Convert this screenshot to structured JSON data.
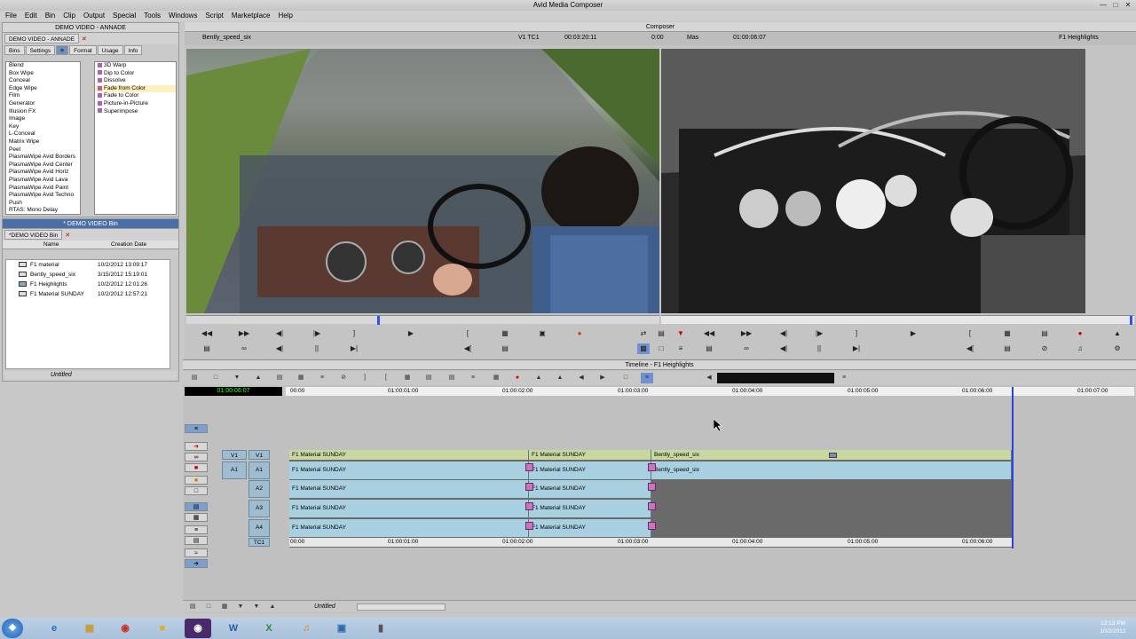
{
  "app": {
    "title": "Avid Media Composer"
  },
  "menu": [
    "File",
    "Edit",
    "Bin",
    "Clip",
    "Output",
    "Special",
    "Tools",
    "Windows",
    "Script",
    "Marketplace",
    "Help"
  ],
  "effects_palette": {
    "title": "DEMO VIDEO - ANNADE",
    "tab_title": "DEMO VIDEO - ANNADE",
    "tabs": [
      "Bins",
      "Settings",
      "Format",
      "Usage",
      "Info"
    ],
    "categories": [
      "Blend",
      "Box Wipe",
      "Conceal",
      "Edge Wipe",
      "Film",
      "Generator",
      "Illusion FX",
      "Image",
      "Key",
      "L-Conceal",
      "Matrix Wipe",
      "Peel",
      "PlasmaWipe Avid Borders",
      "PlasmaWipe Avid Center",
      "PlasmaWipe Avid Horiz",
      "PlasmaWipe Avid Lava",
      "PlasmaWipe Avid Paint",
      "PlasmaWipe Avid Techno",
      "Push",
      "RTAS: Mono Delay"
    ],
    "effects": [
      "3D Warp",
      "Dip to Color",
      "Dissolve",
      "Fade from Color",
      "Fade to Color",
      "Picture-in-Picture",
      "Superimpose"
    ]
  },
  "bin": {
    "window_title": "* DEMO VIDEO Bin",
    "tab_title": "*DEMO VIDEO Bin",
    "columns": [
      "Name",
      "Creation Date"
    ],
    "rows": [
      {
        "name": "F1 material",
        "date": "10/2/2012 13:09:17"
      },
      {
        "name": "Bently_speed_six",
        "date": "3/15/2012 15:19:01"
      },
      {
        "name": "F1 Heighlights",
        "date": "10/2/2012 12:01:26"
      },
      {
        "name": "F1 Material SUNDAY",
        "date": "10/2/2012 12:57:21"
      }
    ],
    "footer_label": "Untitled"
  },
  "composer": {
    "title": "Composer",
    "source_name": "Bently_speed_six",
    "track_tc": "V1  TC1",
    "tc_value": "00:03:20:11",
    "duration": "0:00",
    "mas_label": "Mas",
    "mas_value": "01:00:06:07",
    "record_name": "F1 Heighlights"
  },
  "timeline": {
    "title": "Timeline - F1 Heighlights",
    "current_tc": "01:00:06:07",
    "ruler_labels": [
      "00:00",
      "01:00:01:00",
      "01:00:02:00",
      "01:00:03:00",
      "01:00:04:00",
      "01:00:05:00",
      "01:00:06:00",
      "01:00:07:00"
    ],
    "bottom_labels": [
      "00:00",
      "01:00:01:00",
      "01:00:02:00",
      "01:00:03:00",
      "01:00:04:00",
      "01:00:05:00",
      "01:00:06:00"
    ],
    "tracks": {
      "v1": {
        "label": "V1",
        "source": "V1",
        "clips": [
          "F1 Material SUNDAY",
          "F1 Material SUNDAY",
          "Bently_speed_six"
        ]
      },
      "a1": {
        "label": "A1",
        "source": "A1",
        "clips": [
          "F1 Material SUNDAY",
          "F1 Material SUNDAY",
          "Bently_speed_six"
        ]
      },
      "a2": {
        "label": "A2",
        "clips": [
          "F1 Material SUNDAY",
          "F1 Material SUNDAY"
        ]
      },
      "a3": {
        "label": "A3",
        "clips": [
          "F1 Material SUNDAY",
          "F1 Material SUNDAY"
        ]
      },
      "a4": {
        "label": "A4",
        "clips": [
          "F1 Material SUNDAY",
          "F1 Material SUNDAY"
        ]
      },
      "tc1": {
        "label": "TC1"
      }
    },
    "footer_label": "Untitled"
  },
  "taskbar": {
    "time": "12:13 PM",
    "date": "10/2/2012",
    "apps": [
      "start-orb",
      "ie",
      "explorer",
      "chrome",
      "folder",
      "avid",
      "word",
      "excel",
      "media",
      "photos",
      "usb"
    ]
  }
}
